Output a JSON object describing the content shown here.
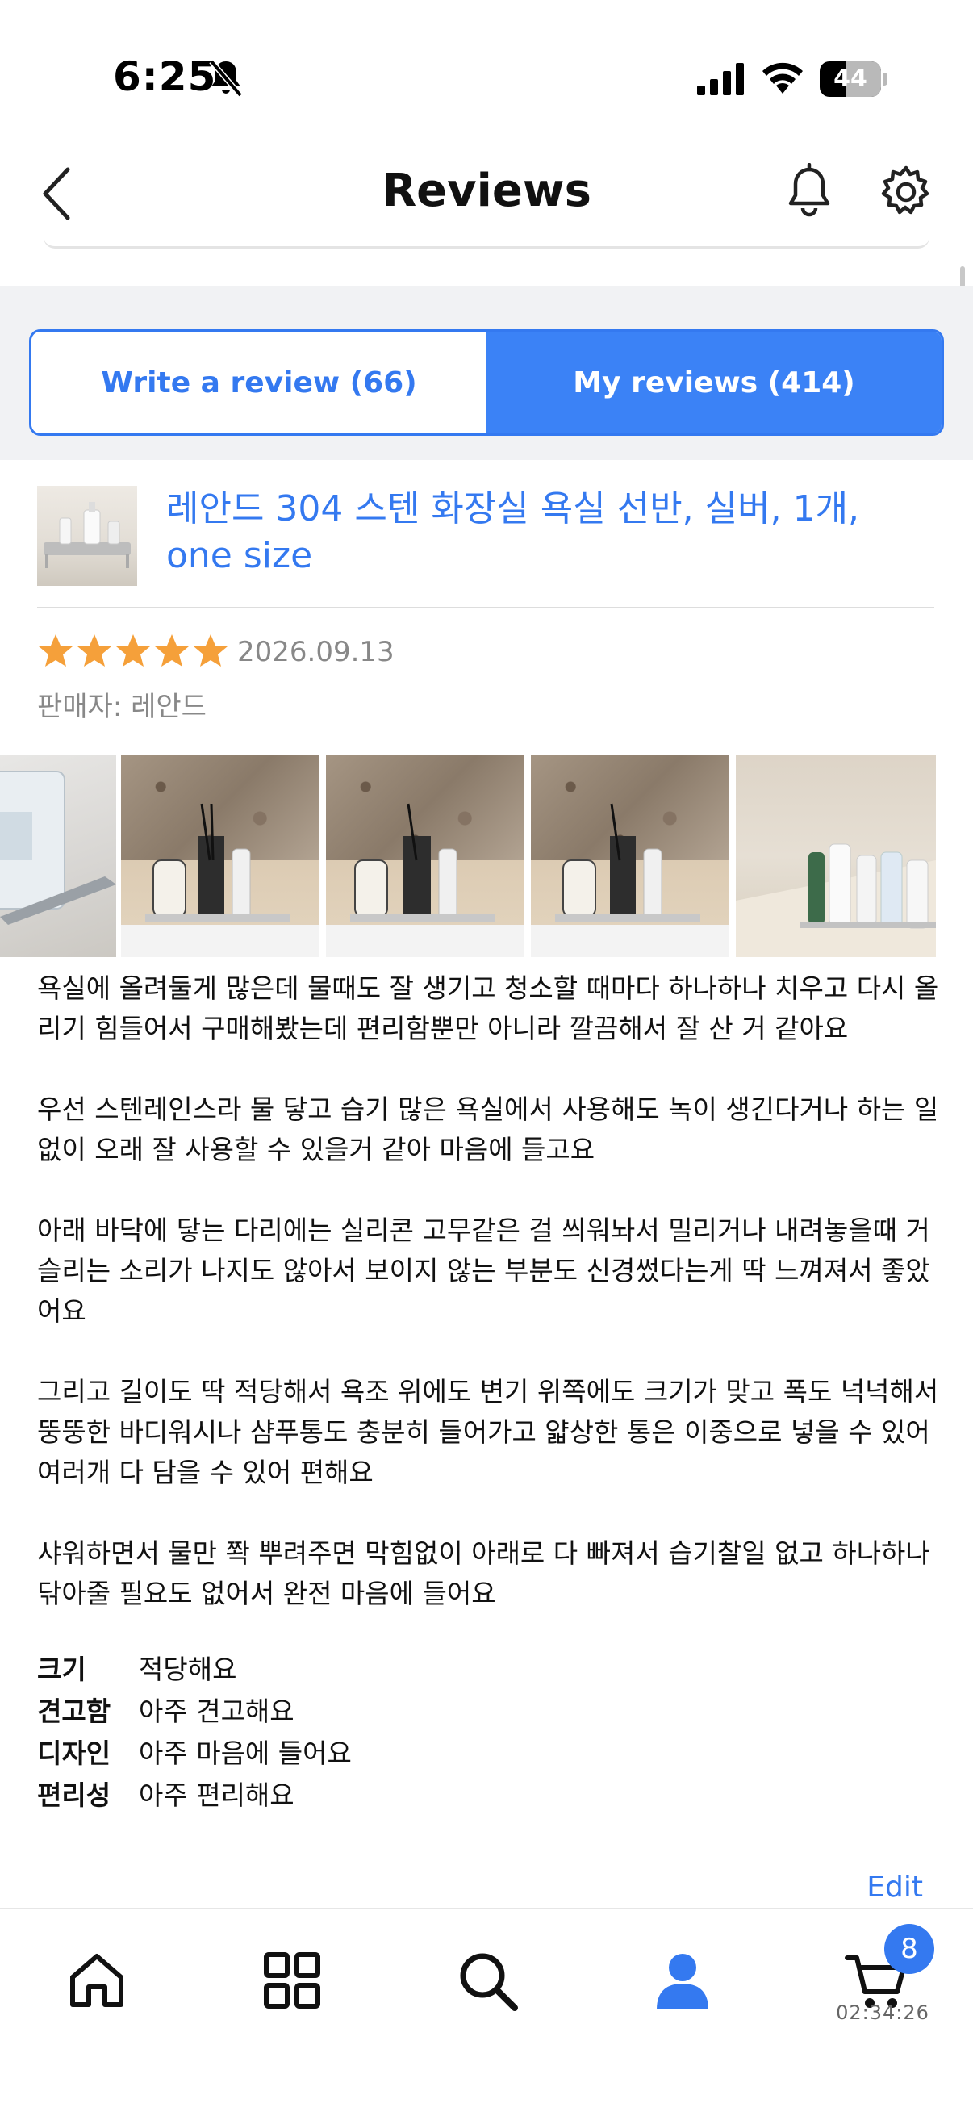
{
  "status_bar": {
    "time": "6:25",
    "battery_pct": "44",
    "battery_level": 0.44
  },
  "header": {
    "title": "Reviews"
  },
  "tabs": [
    {
      "label": "Write a review (66)",
      "active": false
    },
    {
      "label": "My reviews (414)",
      "active": true
    }
  ],
  "product": {
    "name": "레안드 304 스텐 화장실 욕실 선반, 실버, 1개, one size"
  },
  "review": {
    "rating": 5,
    "max_rating": 5,
    "date": "2026.09.13",
    "seller": "판매자: 레안드",
    "photo_count": 5,
    "paragraphs": [
      "욕실에 올려둘게 많은데 물때도 잘 생기고 청소할 때마다 하나하나 치우고 다시 올리기 힘들어서 구매해봤는데 편리함뿐만 아니라 깔끔해서 잘 산 거 같아요",
      "우선 스텐레인스라 물 닿고 습기 많은 욕실에서 사용해도 녹이 생긴다거나 하는 일없이 오래 잘 사용할 수 있을거 같아 마음에 들고요",
      "아래 바닥에 닿는 다리에는 실리콘 고무같은 걸 씌워놔서 밀리거나 내려놓을때 거슬리는 소리가 나지도 않아서 보이지 않는 부분도 신경썼다는게 딱 느껴져서 좋았어요",
      "그리고 길이도 딱 적당해서 욕조 위에도 변기 위쪽에도 크기가 맞고 폭도 넉넉해서 뚱뚱한 바디워시나 샴푸통도 충분히 들어가고 얇상한 통은 이중으로 넣을 수 있어 여러개 다 담을 수 있어 편해요",
      "샤워하면서 물만 쫙 뿌려주면 막힘없이 아래로 다 빠져서 습기찰일 없고 하나하나 닦아줄 필요도 없어서 완전 마음에 들어요"
    ],
    "attributes": [
      {
        "key": "크기",
        "value": "적당해요"
      },
      {
        "key": "견고함",
        "value": "아주 견고해요"
      },
      {
        "key": "디자인",
        "value": "아주 마음에 들어요"
      },
      {
        "key": "편리성",
        "value": "아주 편리해요"
      }
    ],
    "edit_label": "Edit"
  },
  "bottom_nav": {
    "items": [
      {
        "icon": "home-icon",
        "active": false
      },
      {
        "icon": "category-grid-icon",
        "active": false
      },
      {
        "icon": "search-icon",
        "active": false
      },
      {
        "icon": "user-icon",
        "active": true
      },
      {
        "icon": "cart-icon",
        "active": false
      }
    ],
    "cart_count": "8",
    "cart_timer": "02:34:26"
  },
  "colors": {
    "accent": "#3479f0",
    "star": "#f5a03a",
    "muted": "#888888"
  }
}
